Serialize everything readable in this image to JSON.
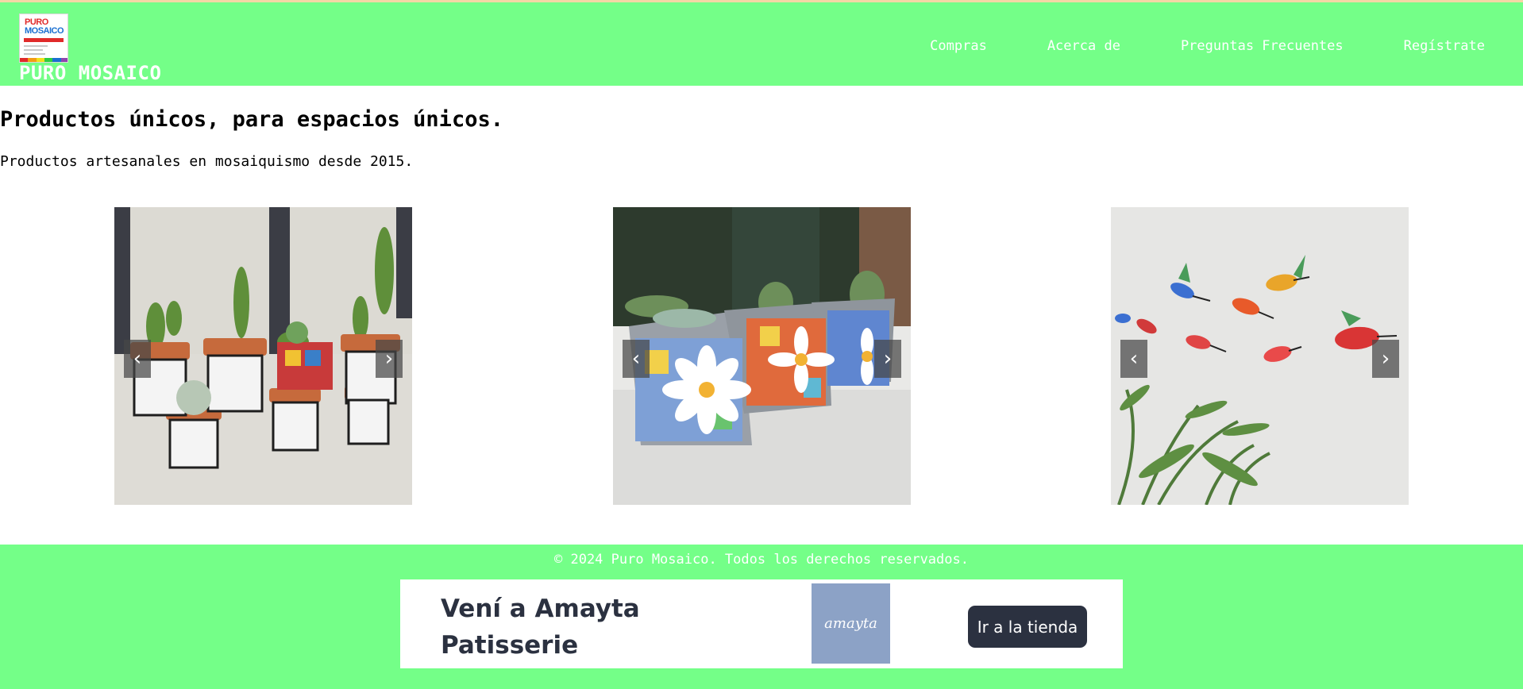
{
  "header": {
    "logo": {
      "line1": "PURO",
      "line2": "MOSAICO"
    },
    "brand_name": "PURO MOSAICO",
    "nav": [
      "Compras",
      "Acerca de",
      "Preguntas Frecuentes",
      "Regístrate"
    ]
  },
  "hero": {
    "title": "Productos únicos, para espacios únicos.",
    "subtitle": "Productos artesanales en mosaiquismo desde 2015."
  },
  "carousels": [
    {
      "prev": "‹",
      "next": "›"
    },
    {
      "prev": "‹",
      "next": "›"
    },
    {
      "prev": "‹",
      "next": "›"
    }
  ],
  "footer": {
    "copyright": "© 2024 Puro Mosaico. Todos los derechos reservados."
  },
  "ad": {
    "title": "Vení a Amayta Patisserie",
    "logo_text": "amayta",
    "button": "Ir a la tienda"
  },
  "colors": {
    "header_bg": "#74ff88",
    "footer_bg": "#74ff88",
    "ad_text": "#2b3140",
    "ad_logo_bg": "#8ca2c6"
  }
}
